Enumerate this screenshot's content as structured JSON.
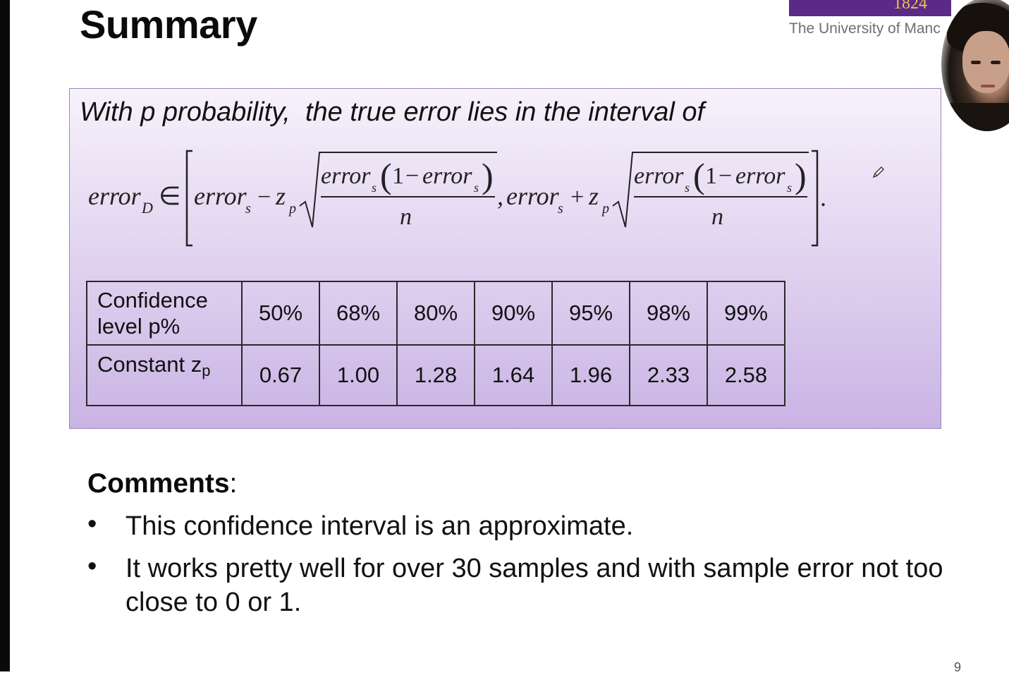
{
  "slide": {
    "title": "Summary",
    "page_number": "9"
  },
  "branding": {
    "logo_year": "1824",
    "university_name": "The University of Manchester",
    "colors": {
      "purple": "#5b2a86",
      "gold": "#f2c14a"
    }
  },
  "webcam": {
    "presenter": "presenter-video-feed"
  },
  "formula_box": {
    "intro": "With p probability,  the true error lies in the interval of",
    "formula": {
      "lhs": "error",
      "lhs_sub": "D",
      "in_symbol": "∈",
      "term": "error",
      "term_sub": "s",
      "minus": "−",
      "plus": "+",
      "z": "z",
      "z_sub": "p",
      "numerator_one": "1",
      "numerator_minus": "−",
      "denominator": "n",
      "comma": ",",
      "period": "."
    },
    "table": {
      "row1_header": [
        "Confidence",
        "level p%"
      ],
      "row2_header": "Constant z",
      "row2_header_sub": "p",
      "confidence_levels": [
        "50%",
        "68%",
        "80%",
        "90%",
        "95%",
        "98%",
        "99%"
      ],
      "z_values": [
        "0.67",
        "1.00",
        "1.28",
        "1.64",
        "1.96",
        "2.33",
        "2.58"
      ]
    }
  },
  "comments": {
    "heading": "Comments",
    "heading_suffix": ":",
    "bullet_symbol": "•",
    "items": [
      "This confidence interval is an approximate.",
      "It works pretty well for over 30 samples and with sample error not too close to 0 or 1."
    ]
  },
  "icons": {
    "pencil": "pencil-cursor-icon"
  }
}
